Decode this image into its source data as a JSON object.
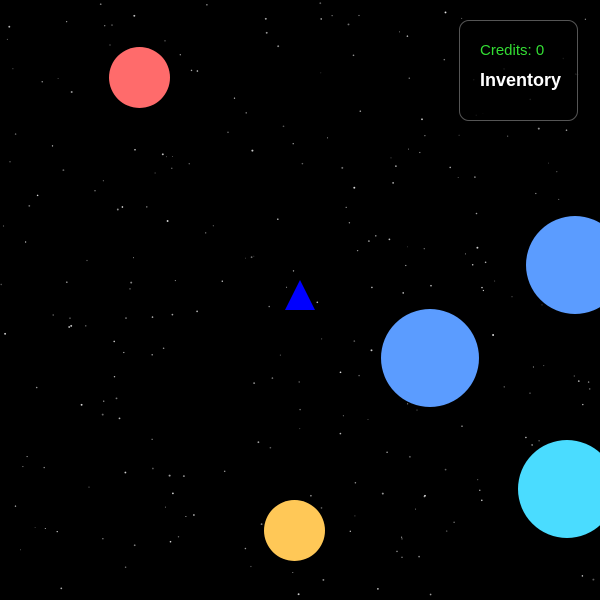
{
  "hud": {
    "credits_text": "Credits: 0",
    "inventory_label": "Inventory",
    "credits_color": "#33dd33"
  },
  "colors": {
    "background": "#000000",
    "ship": "#0000ff",
    "star": "#ffffff"
  },
  "planets": [
    {
      "name": "red-planet",
      "color": "#ff6b6b"
    },
    {
      "name": "blue-planet-right",
      "color": "#5b9cff"
    },
    {
      "name": "blue-planet-center",
      "color": "#5b9cff"
    },
    {
      "name": "cyan-planet",
      "color": "#4adcff"
    },
    {
      "name": "yellow-planet",
      "color": "#ffc857"
    }
  ],
  "ship": {
    "icon": "triangle-ship-icon"
  }
}
